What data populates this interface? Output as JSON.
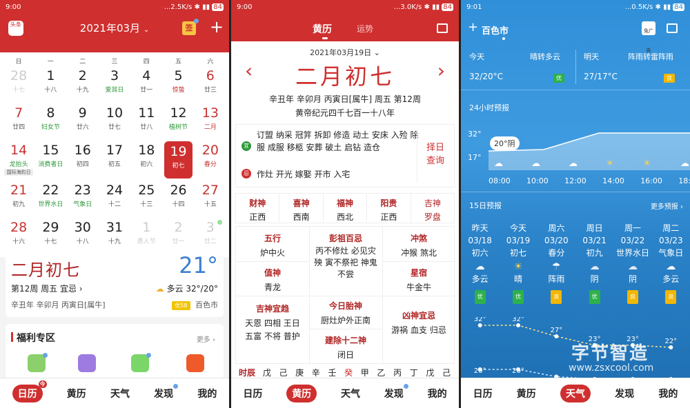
{
  "panel1": {
    "status": {
      "time": "9:00",
      "speed": "...2.5K/s",
      "battery": "84"
    },
    "logo_text": "头条",
    "month_title": "2021年03月",
    "weekdays": [
      "日",
      "一",
      "二",
      "三",
      "四",
      "五",
      "六"
    ],
    "days": [
      {
        "n": "28",
        "l": "十七",
        "cls": "fade"
      },
      {
        "n": "1",
        "l": "十八",
        "cls": ""
      },
      {
        "n": "2",
        "l": "十九",
        "cls": ""
      },
      {
        "n": "3",
        "l": "爱耳日",
        "cls": "",
        "lc": "g"
      },
      {
        "n": "4",
        "l": "廿一",
        "cls": ""
      },
      {
        "n": "5",
        "l": "惊蛰",
        "cls": "",
        "lc": "r"
      },
      {
        "n": "6",
        "l": "廿三",
        "cls": "we"
      },
      {
        "n": "7",
        "l": "廿四",
        "cls": "we"
      },
      {
        "n": "8",
        "l": "妇女节",
        "cls": "",
        "lc": "g"
      },
      {
        "n": "9",
        "l": "廿六",
        "cls": ""
      },
      {
        "n": "10",
        "l": "廿七",
        "cls": ""
      },
      {
        "n": "11",
        "l": "廿八",
        "cls": ""
      },
      {
        "n": "12",
        "l": "植树节",
        "cls": "",
        "lc": "g"
      },
      {
        "n": "13",
        "l": "二月",
        "cls": "we",
        "lc": "r"
      },
      {
        "n": "14",
        "l": "龙抬头",
        "cls": "we",
        "lc": "g"
      },
      {
        "n": "15",
        "l": "消费者日",
        "cls": "",
        "lc": "g"
      },
      {
        "n": "16",
        "l": "初四",
        "cls": ""
      },
      {
        "n": "17",
        "l": "初五",
        "cls": ""
      },
      {
        "n": "18",
        "l": "初六",
        "cls": ""
      },
      {
        "n": "19",
        "l": "初七",
        "cls": "sel"
      },
      {
        "n": "20",
        "l": "春分",
        "cls": "we",
        "lc": "r"
      },
      {
        "n": "21",
        "l": "初九",
        "cls": "we"
      },
      {
        "n": "22",
        "l": "世界水日",
        "cls": "",
        "lc": "g"
      },
      {
        "n": "23",
        "l": "气象日",
        "cls": "",
        "lc": "g"
      },
      {
        "n": "24",
        "l": "十二",
        "cls": ""
      },
      {
        "n": "25",
        "l": "十三",
        "cls": ""
      },
      {
        "n": "26",
        "l": "十四",
        "cls": ""
      },
      {
        "n": "27",
        "l": "十五",
        "cls": "we"
      },
      {
        "n": "28",
        "l": "十六",
        "cls": "we"
      },
      {
        "n": "29",
        "l": "十七",
        "cls": ""
      },
      {
        "n": "30",
        "l": "十八",
        "cls": ""
      },
      {
        "n": "31",
        "l": "十九",
        "cls": ""
      },
      {
        "n": "1",
        "l": "愚人节",
        "cls": "fade"
      },
      {
        "n": "2",
        "l": "廿一",
        "cls": "fade"
      },
      {
        "n": "3",
        "l": "廿二",
        "cls": "fade"
      }
    ],
    "tag_14": "国际海豹日",
    "card": {
      "lunar": "二月初七",
      "temp": "21°",
      "week_info": "第12周 周五 宜忌 ›",
      "weather": "多云 32°/20°",
      "ganzhi": "辛丑年 辛卯月 丙寅日[属牛]",
      "aqi": "优58",
      "city": "百色市"
    },
    "welfare": {
      "title": "福利专区",
      "more": "更多 ›"
    },
    "nav": [
      "日历",
      "黄历",
      "天气",
      "发现",
      "我的"
    ],
    "nav_badge": "今"
  },
  "panel2": {
    "status": {
      "time": "9:00",
      "speed": "...3.0K/s",
      "battery": "84"
    },
    "tabs": [
      "黄历",
      "运势"
    ],
    "date": "2021年03月19日",
    "lunar": "二月初七",
    "line1": "辛丑年 辛卯月 丙寅日[属牛] 周五 第12周",
    "line2": "黄帝纪元四千七百一十八年",
    "yi_tag": "宜",
    "yi": "订盟 纳采 冠笄 拆卸 修造 动土 安床 入殓 除服 成服 移柩 安葬 破土 启钻 造仓",
    "ji_tag": "忌",
    "ji": "作灶 开光 嫁娶 开市 入宅",
    "select_day": "择日查询",
    "gods": [
      {
        "k": "财神",
        "v": "正西"
      },
      {
        "k": "喜神",
        "v": "西南"
      },
      {
        "k": "福神",
        "v": "西北"
      },
      {
        "k": "阳贵",
        "v": "正西"
      },
      {
        "k": "吉神",
        "v": "罗盘"
      }
    ],
    "wuxing": {
      "k": "五行",
      "v": "炉中火"
    },
    "pengzu": {
      "k": "彭祖百忌",
      "v": "丙不修灶 必见灾殃 寅不祭祀 神鬼不尝"
    },
    "chongsha": {
      "k": "冲煞",
      "v": "冲猴 煞北"
    },
    "zhishen": {
      "k": "值神",
      "v": "青龙"
    },
    "xingxiu": {
      "k": "星宿",
      "v": "牛金牛"
    },
    "jishen": {
      "k": "吉神宜趋",
      "v": "天恩 四相 王日 五富 不将 普护"
    },
    "taishen": {
      "k": "今日胎神",
      "v": "厨灶炉外正南"
    },
    "jianchu": {
      "k": "建除十二神",
      "v": "闭日"
    },
    "xiongsha": {
      "k": "凶神宜忌",
      "v": "游祸 血支 归忌"
    },
    "shichen_label": "时辰",
    "shichen": [
      "戊",
      "己",
      "庚",
      "辛",
      "壬",
      "癸",
      "甲",
      "乙",
      "丙",
      "丁",
      "戊",
      "己"
    ],
    "nav": [
      "日历",
      "黄历",
      "天气",
      "发现",
      "我的"
    ]
  },
  "panel3": {
    "status": {
      "time": "9:01",
      "speed": "...0.5K/s",
      "battery": "84"
    },
    "city": "百色市",
    "ad_label": "免广告",
    "today": {
      "label": "今天",
      "desc": "晴转多云",
      "temp": "32/20°C",
      "aqi": "优"
    },
    "tomorrow": {
      "label": "明天",
      "desc": "阵雨转雷阵雨",
      "temp": "27/17°C",
      "aqi": "良"
    },
    "h24_title": "24小时预报",
    "h24_y": [
      "32°",
      "17°"
    ],
    "h24_tip": "20°阴",
    "h24_times": [
      "08:00",
      "10:00",
      "12:00",
      "14:00",
      "16:00",
      "18:0"
    ],
    "d15_title": "15日预报",
    "d15_more": "更多预报 ›",
    "days": [
      {
        "w": "昨天",
        "d": "03/18",
        "l": "初六",
        "c": "多云",
        "a": "优",
        "hi": 32,
        "lo": 20
      },
      {
        "w": "今天",
        "d": "03/19",
        "l": "初七",
        "c": "晴",
        "a": "优",
        "hi": 32,
        "lo": 20
      },
      {
        "w": "周六",
        "d": "03/20",
        "l": "春分",
        "c": "阵雨",
        "a": "良",
        "hi": 27,
        "lo": 17
      },
      {
        "w": "周日",
        "d": "03/21",
        "l": "初九",
        "c": "阴",
        "a": "优",
        "hi": 23,
        "lo": 16
      },
      {
        "w": "周一",
        "d": "03/22",
        "l": "世界水日",
        "c": "阴",
        "a": "良",
        "hi": 23,
        "lo": 16
      },
      {
        "w": "周二",
        "d": "03/23",
        "l": "气象日",
        "c": "多云",
        "a": "良",
        "hi": 22,
        "lo": 16
      }
    ],
    "hi_labels": [
      "32°",
      "32°",
      "27°",
      "23°",
      "23°",
      "22°"
    ],
    "lo_labels": [
      "20°",
      "20°"
    ],
    "watermark1": "字节智造",
    "watermark2": "www.zsxcool.com",
    "nav": [
      "日历",
      "黄历",
      "天气",
      "发现",
      "我的"
    ]
  },
  "colors": {
    "red": "#cf2f2f",
    "green": "#2db14a",
    "yellow": "#f2b705"
  }
}
